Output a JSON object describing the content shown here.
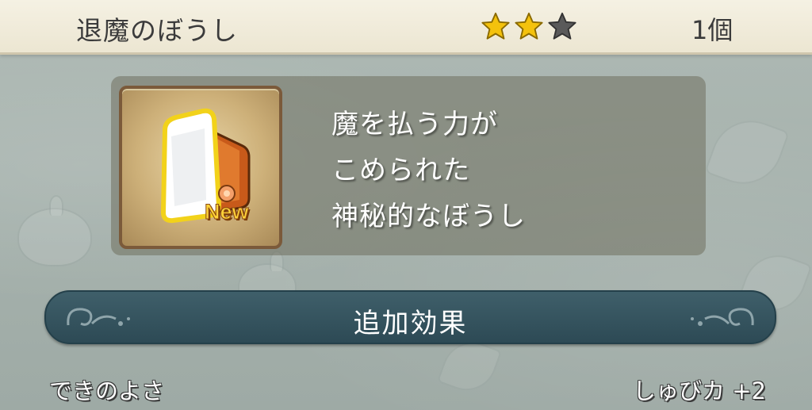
{
  "header": {
    "item_name": "退魔のぼうし",
    "rarity": {
      "filled": 2,
      "total": 3
    },
    "quantity": "1個"
  },
  "item": {
    "icon": "hat-icon",
    "badge": "New",
    "description": [
      "魔を払う力が",
      "こめられた",
      "神秘的なぼうし"
    ]
  },
  "section": {
    "title": "追加効果"
  },
  "stats": {
    "label": "できのよさ",
    "value": "しゅびカ +2"
  },
  "colors": {
    "star_filled": "#f4c20d",
    "star_empty": "#5a5a5a",
    "banner": "#2d4a55",
    "header_bg": "#f0ebd8"
  }
}
